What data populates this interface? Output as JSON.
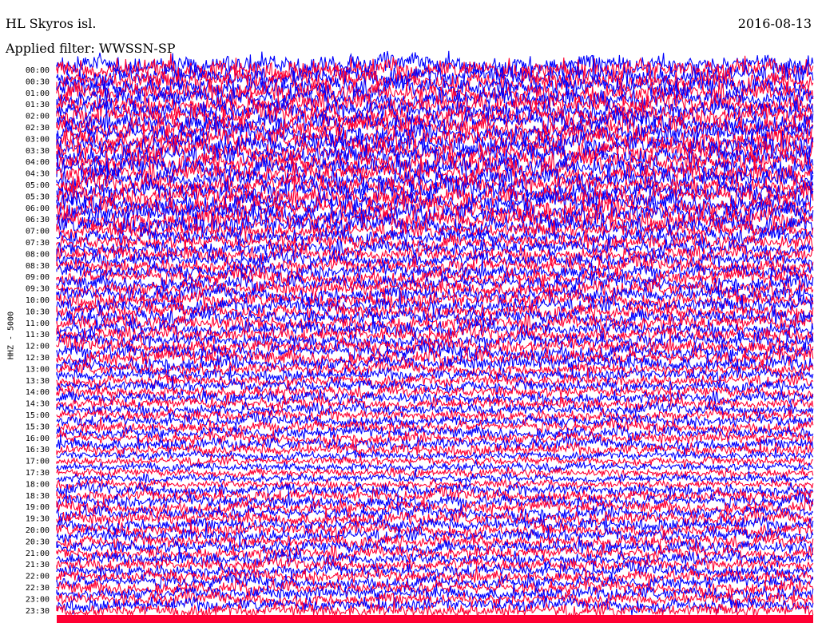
{
  "header": {
    "title": "HL Skyros isl.",
    "date": "2016-08-13",
    "filter": "Applied filter: WWSSN-SP"
  },
  "chart_data": {
    "type": "line",
    "title": "HL Skyros isl.",
    "ylabel": "HHZ - 5000",
    "y_tick_labels": [
      "00:00",
      "00:30",
      "01:00",
      "01:30",
      "02:00",
      "02:30",
      "03:00",
      "03:30",
      "04:00",
      "04:30",
      "05:00",
      "05:30",
      "06:00",
      "06:30",
      "07:00",
      "07:30",
      "08:00",
      "08:30",
      "09:00",
      "09:30",
      "10:00",
      "10:30",
      "11:00",
      "11:30",
      "12:00",
      "12:30",
      "13:00",
      "13:30",
      "14:00",
      "14:30",
      "15:00",
      "15:30",
      "16:00",
      "16:30",
      "17:00",
      "17:30",
      "18:00",
      "18:30",
      "19:00",
      "19:30",
      "20:00",
      "20:30",
      "21:00",
      "21:30",
      "22:00",
      "22:30",
      "23:00",
      "23:30"
    ],
    "trace_colors": [
      "#0000ff",
      "#ff0033"
    ],
    "color_pattern": "alternating per 15-minute line",
    "traces_per_label": 2,
    "grid": false
  }
}
